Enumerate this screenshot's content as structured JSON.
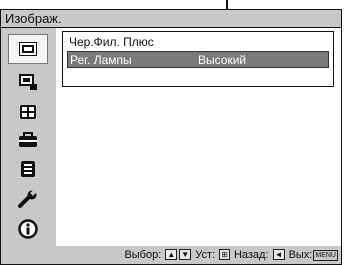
{
  "header": {
    "title": "Изображ."
  },
  "sidebar": {
    "items": [
      {
        "icon": "picture-icon",
        "selected": true
      },
      {
        "icon": "picture-setting-icon",
        "selected": false
      },
      {
        "icon": "screen-icon",
        "selected": false
      },
      {
        "icon": "setup-icon",
        "selected": false
      },
      {
        "icon": "function-icon",
        "selected": false
      },
      {
        "icon": "wrench-icon",
        "selected": false
      },
      {
        "icon": "info-icon",
        "selected": false
      }
    ]
  },
  "settings": {
    "rows": [
      {
        "label": "Чер.Фил. Плюс",
        "value": ""
      },
      {
        "label": "Рег. Лампы",
        "value": "Высокий"
      }
    ],
    "selected_index": 1
  },
  "footer": {
    "select_label": "Выбор:",
    "set_label": "Уст:",
    "back_label": "Назад:",
    "exit_label": "Вых:",
    "menu_key": "MENU"
  },
  "colors": {
    "panel_gray": "#c8c8c8",
    "selected_row": "#7a7a7a"
  }
}
